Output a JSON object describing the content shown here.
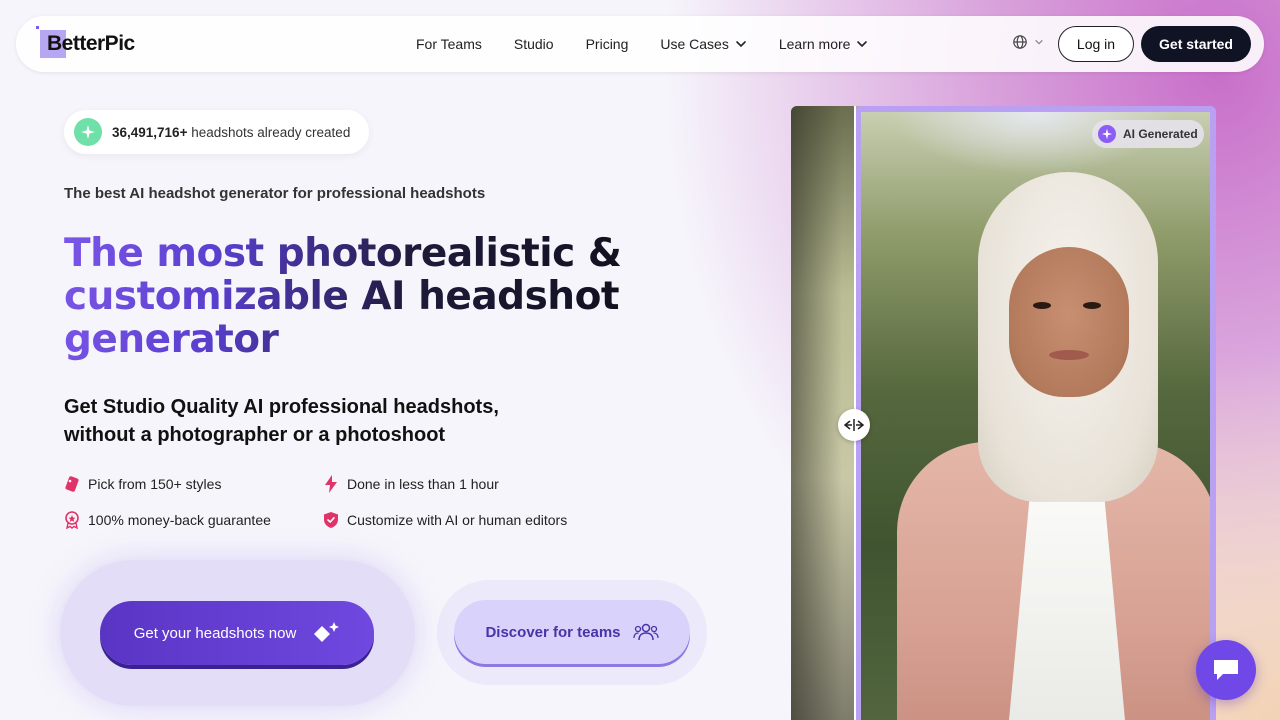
{
  "brand": {
    "name": "BetterPic"
  },
  "nav": {
    "links": [
      {
        "label": "For Teams"
      },
      {
        "label": "Studio"
      },
      {
        "label": "Pricing"
      },
      {
        "label": "Use Cases"
      },
      {
        "label": "Learn more"
      }
    ],
    "login_label": "Log in",
    "cta_label": "Get started"
  },
  "hero": {
    "counter_number": "36,491,716+",
    "counter_text": "headshots already created",
    "tagline": "The best AI headshot generator for professional headshots",
    "headline": "The most photorealistic & customizable AI headshot generator",
    "subhead": "Get Studio Quality AI professional headshots, without a photographer or a photoshoot",
    "features": [
      {
        "label": "Pick from 150+ styles",
        "icon": "tag-icon"
      },
      {
        "label": "Done in less than 1 hour",
        "icon": "lightning-icon"
      },
      {
        "label": "100% money-back guarantee",
        "icon": "award-icon"
      },
      {
        "label": "Customize with AI or human editors",
        "icon": "shield-icon"
      }
    ],
    "primary_cta": "Get your headshots now",
    "secondary_cta": "Discover for teams",
    "image_badge": "AI Generated"
  },
  "colors": {
    "accent": "#6f48e0",
    "dark": "#0f1324",
    "counter_icon_bg": "#6fe0a8",
    "feature_icon": "#e0336a",
    "frame_border": "#b9a0f2"
  }
}
